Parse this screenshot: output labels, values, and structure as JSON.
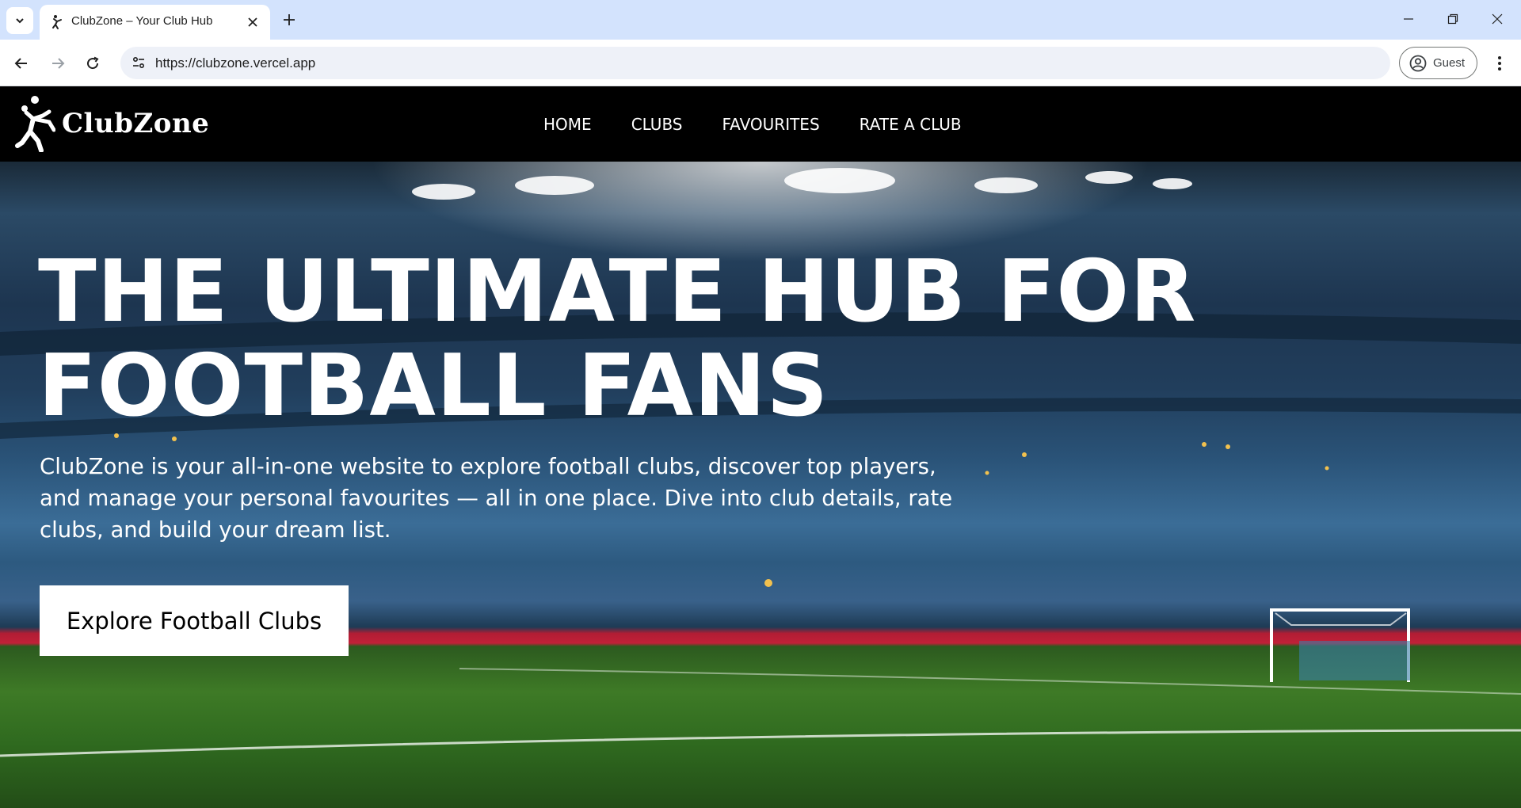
{
  "browser": {
    "tab_title": "ClubZone – Your Club Hub",
    "url": "https://clubzone.vercel.app",
    "profile_label": "Guest",
    "icons": [
      "tab-search-icon",
      "favicon-icon",
      "close-icon",
      "plus-icon",
      "minimize-icon",
      "restore-icon",
      "close-window-icon",
      "back-arrow-icon",
      "forward-arrow-icon",
      "reload-icon",
      "site-settings-icon",
      "profile-icon",
      "kebab-menu-icon"
    ]
  },
  "site": {
    "logo_text": "ClubZone",
    "nav": [
      {
        "label": "HOME"
      },
      {
        "label": "CLUBS"
      },
      {
        "label": "FAVOURITES"
      },
      {
        "label": "RATE A CLUB"
      }
    ]
  },
  "hero": {
    "title_line1": "THE ULTIMATE HUB FOR",
    "title_line2": "FOOTBALL FANS",
    "description": "ClubZone is your all-in-one website to explore football clubs, discover top players, and manage your personal favourites — all in one place. Dive into club details, rate clubs, and build your dream list.",
    "cta_label": "Explore Football Clubs"
  },
  "colors": {
    "tabstrip": "#d3e3fd",
    "header_bg": "#000000",
    "text": "#ffffff",
    "cta_bg": "#ffffff"
  }
}
